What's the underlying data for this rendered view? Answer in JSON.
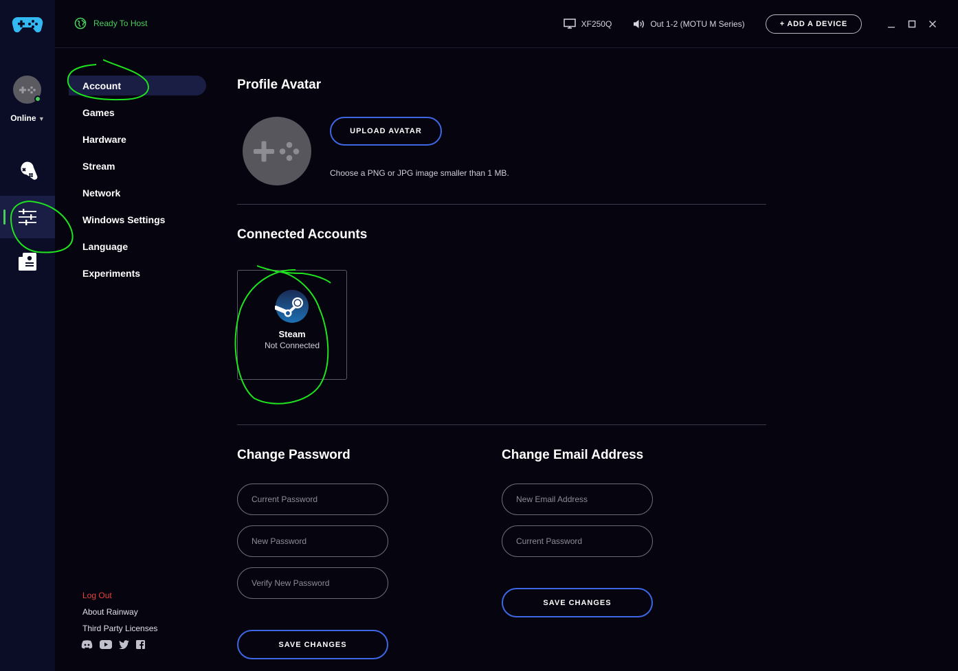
{
  "header": {
    "status": "Ready To Host",
    "display": "XF250Q",
    "audio": "Out 1-2 (MOTU M Series)",
    "add_device": "+ ADD A DEVICE"
  },
  "rail": {
    "status": "Online"
  },
  "nav": {
    "items": [
      {
        "label": "Account"
      },
      {
        "label": "Games"
      },
      {
        "label": "Hardware"
      },
      {
        "label": "Stream"
      },
      {
        "label": "Network"
      },
      {
        "label": "Windows Settings"
      },
      {
        "label": "Language"
      },
      {
        "label": "Experiments"
      }
    ],
    "active": "Account"
  },
  "footer": {
    "logout": "Log Out",
    "about": "About Rainway",
    "licenses": "Third Party Licenses"
  },
  "profile": {
    "title": "Profile Avatar",
    "upload": "UPLOAD AVATAR",
    "hint": "Choose a PNG or JPG image smaller than 1 MB."
  },
  "accounts": {
    "title": "Connected Accounts",
    "steam": {
      "name": "Steam",
      "status": "Not Connected"
    }
  },
  "password": {
    "title": "Change Password",
    "current": "Current Password",
    "new": "New Password",
    "verify": "Verify New Password",
    "save": "SAVE CHANGES"
  },
  "email": {
    "title": "Change Email Address",
    "new": "New Email Address",
    "current": "Current Password",
    "save": "SAVE CHANGES"
  },
  "colors": {
    "accent_green": "#49cf5c",
    "button_blue": "#3e67e6",
    "logout_red": "#e8423a",
    "rail_bg": "#0b0d27"
  }
}
